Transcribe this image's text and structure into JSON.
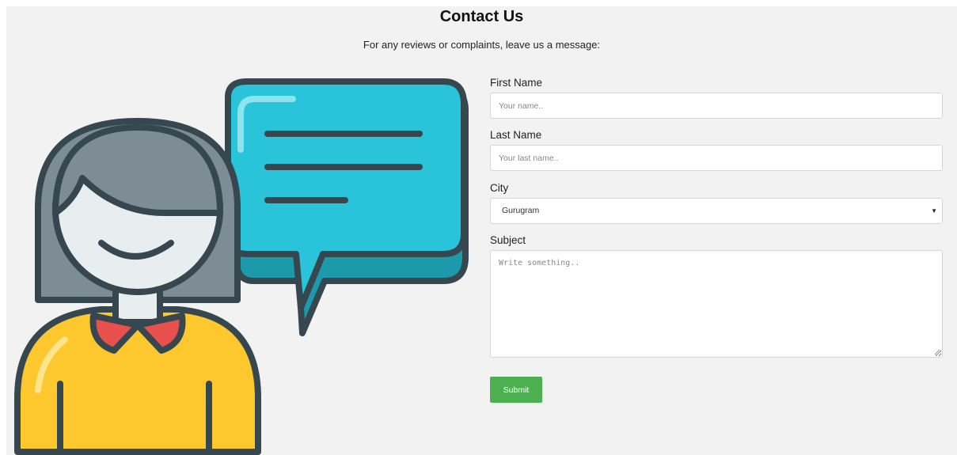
{
  "header": {
    "title": "Contact Us",
    "subtitle": "For any reviews or complaints, leave us a message:"
  },
  "illustration": {
    "icon": "person-with-speech-bubble-icon",
    "colors": {
      "bubble": "#29c4d9",
      "bubble_shadow": "#1c99aa",
      "hair": "#7e8c96",
      "face": "#e8edf0",
      "shirt": "#fdc72e",
      "collar": "#e8504d",
      "outline": "#37474f"
    }
  },
  "form": {
    "first_name": {
      "label": "First Name",
      "placeholder": "Your name.."
    },
    "last_name": {
      "label": "Last Name",
      "placeholder": "Your last name.."
    },
    "city": {
      "label": "City",
      "selected": "Gurugram",
      "icon": "caret-down-icon"
    },
    "subject": {
      "label": "Subject",
      "placeholder": "Write something.."
    },
    "submit_label": "Submit"
  },
  "colors": {
    "page_background": "#f2f2f2",
    "submit_button": "#4caf50",
    "input_border": "#d6d6d6"
  }
}
